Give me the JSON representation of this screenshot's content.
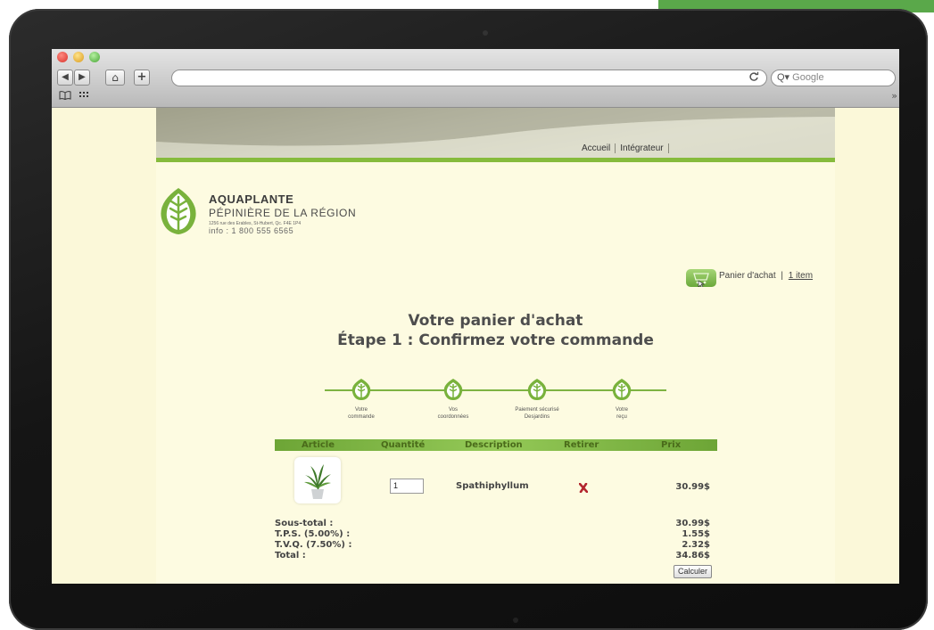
{
  "browser": {
    "search_placeholder": "Google",
    "reload_glyph": "C",
    "nav": {
      "back": "◀",
      "forward": "▶",
      "home": "⌂",
      "add": "+"
    },
    "bookmark_icons": [
      "book-icon",
      "grid-icon"
    ],
    "overflow": "»"
  },
  "site": {
    "top_nav": [
      "Accueil",
      "Intégrateur"
    ],
    "brand": {
      "name": "AQUAPLANTE",
      "tagline": "PÉPINIÈRE DE LA RÉGION",
      "address": "1256 rue des Erables, St-Hubert, Qc. F4E 1P4",
      "info": "info : 1 800 555 6565"
    },
    "cart": {
      "label": "Panier d'achat",
      "separator": "|",
      "items": "1 item"
    }
  },
  "page": {
    "title": "Votre panier d'achat",
    "subtitle": "Étape 1 : Confirmez votre commande",
    "steps": [
      {
        "line1": "Votre",
        "line2": "commande"
      },
      {
        "line1": "Vos",
        "line2": "coordonnées"
      },
      {
        "line1": "Paiement sécurisé",
        "line2": "Desjardins"
      },
      {
        "line1": "Votre",
        "line2": "reçu"
      }
    ]
  },
  "table": {
    "headers": [
      "Article",
      "Quantité",
      "Description",
      "Retirer",
      "Prix"
    ],
    "row": {
      "quantity": "1",
      "description": "Spathiphyllum",
      "price": "30.99$"
    },
    "totals": [
      {
        "label": "Sous-total :",
        "value": "30.99$"
      },
      {
        "label": "T.P.S. (5.00%) :",
        "value": "1.55$"
      },
      {
        "label": "T.V.Q. (7.50%) :",
        "value": "2.32$"
      },
      {
        "label": "Total :",
        "value": "34.86$"
      }
    ],
    "calculate_label": "Calculer"
  },
  "colors": {
    "brand_green": "#86bb3c",
    "page_bg": "#fdfbe1",
    "remove_red": "#b3262e"
  }
}
